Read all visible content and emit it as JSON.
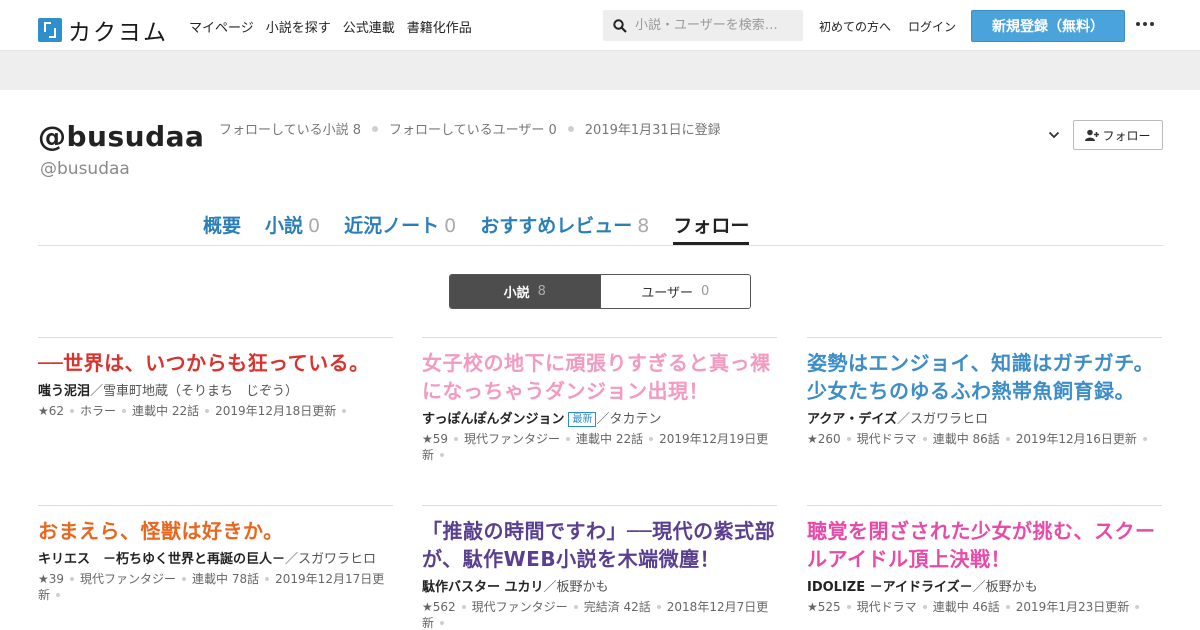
{
  "header": {
    "logo_text": "カクヨム",
    "nav": [
      "マイページ",
      "小説を探す",
      "公式連載",
      "書籍化作品"
    ],
    "search_placeholder": "小説・ユーザーを検索…",
    "first_time": "初めての方へ",
    "login": "ログイン",
    "signup": "新規登録（無料）"
  },
  "profile": {
    "handle": "@busudaa",
    "subhandle": "@busudaa",
    "following_novels": "フォローしている小説 8",
    "following_users": "フォローしているユーザー 0",
    "registered": "2019年1月31日に登録",
    "follow_button": "フォロー"
  },
  "tabs": [
    {
      "label": "概要",
      "count": ""
    },
    {
      "label": "小説",
      "count": "0"
    },
    {
      "label": "近況ノート",
      "count": "0"
    },
    {
      "label": "おすすめレビュー",
      "count": "8"
    },
    {
      "label": "フォロー",
      "count": ""
    }
  ],
  "toggle": {
    "novels_label": "小説",
    "novels_count": "8",
    "users_label": "ユーザー",
    "users_count": "0"
  },
  "cards": [
    {
      "title": "──世界は、いつからも狂っている。",
      "color": "#d9322d",
      "author": "嗤う泥泪",
      "by": "／雪車町地蔵（そりまち　じぞう）",
      "badge": "",
      "info": [
        "★62",
        "ホラー",
        "連載中 22話",
        "2019年12月18日更新"
      ]
    },
    {
      "title": "女子校の地下に頑張りすぎると真っ裸になっちゃうダンジョン出現！",
      "color": "#f29ac2",
      "author": "すっぽんぽんダンジョン",
      "by": "／タカテン",
      "badge": "最新",
      "info": [
        "★59",
        "現代ファンタジー",
        "連載中 22話",
        "2019年12月19日更新"
      ]
    },
    {
      "title": "姿勢はエンジョイ、知識はガチガチ。少女たちのゆるふわ熱帯魚飼育録。",
      "color": "#3d8dc8",
      "author": "アクア・デイズ",
      "by": "／スガワラヒロ",
      "badge": "",
      "info": [
        "★260",
        "現代ドラマ",
        "連載中 86話",
        "2019年12月16日更新"
      ]
    },
    {
      "title": "おまえら、怪獣は好きか。",
      "color": "#e8661e",
      "author": "キリエス　－朽ちゆく世界と再誕の巨人－",
      "by": "／スガワラヒロ",
      "badge": "",
      "info": [
        "★39",
        "現代ファンタジー",
        "連載中 78話",
        "2019年12月17日更新"
      ]
    },
    {
      "title": "「推敲の時間ですわ」──現代の紫式部が、駄作WEB小説を木端微塵！",
      "color": "#5a3f91",
      "author": "駄作バスター ユカリ",
      "by": "／板野かも",
      "badge": "",
      "info": [
        "★562",
        "現代ファンタジー",
        "完結済 42話",
        "2018年12月7日更新"
      ]
    },
    {
      "title": "聴覚を閉ざされた少女が挑む、スクールアイドル頂上決戦！",
      "color": "#e84aa8",
      "author": "IDOLIZE －アイドライズ－",
      "by": "／板野かも",
      "badge": "",
      "info": [
        "★525",
        "現代ドラマ",
        "連載中 46話",
        "2019年1月23日更新"
      ]
    }
  ]
}
